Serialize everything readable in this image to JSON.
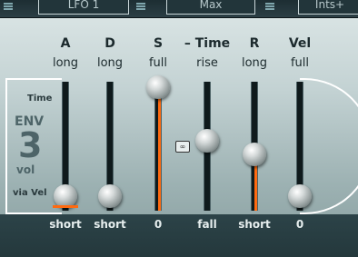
{
  "topbar": {
    "btn1": "LFO 1",
    "btn2": "Max",
    "btn3": "Ints+"
  },
  "columns": [
    {
      "label": "A",
      "sub": "long",
      "bottom": "short",
      "level": 0.06
    },
    {
      "label": "D",
      "sub": "long",
      "bottom": "short",
      "level": 0.06
    },
    {
      "label": "S",
      "sub": "full",
      "bottom": "0",
      "level": 1.0
    },
    {
      "label": "– Time",
      "sub": "rise",
      "bottom": "fall",
      "level": 0.54
    },
    {
      "label": "R",
      "sub": "long",
      "bottom": "short",
      "level": 0.42
    },
    {
      "label": "Vel",
      "sub": "full",
      "bottom": "0",
      "level": 0.06
    }
  ],
  "side": {
    "time_label": "Time",
    "env_label": "ENV",
    "env_number": "3",
    "env_sub": "vol",
    "via_label": "via Vel"
  },
  "link_icon": "link-icon",
  "colors": {
    "fill_accent": "#ff6a10",
    "panel_top": "#d8e3e3",
    "panel_bottom": "#889e9f"
  }
}
